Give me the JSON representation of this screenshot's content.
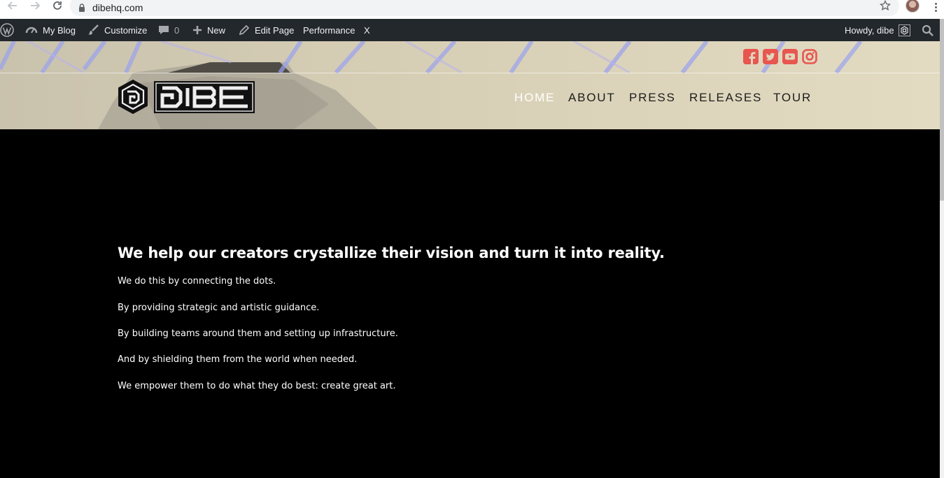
{
  "browser": {
    "url": "dibehq.com",
    "icons": [
      "back-arrow-icon",
      "forward-arrow-icon",
      "reload-icon",
      "lock-icon",
      "bookmark-star-icon",
      "profile-avatar",
      "chrome-menu-icon"
    ]
  },
  "admin_bar": {
    "my_blog": "My Blog",
    "customize": "Customize",
    "comments_count": "0",
    "new": "New",
    "edit_page": "Edit Page",
    "performance": "Performance",
    "x": "X",
    "howdy": "Howdy, dibe",
    "background": "#23282d"
  },
  "header": {
    "social": [
      {
        "name": "facebook",
        "icon": "facebook-icon"
      },
      {
        "name": "twitter",
        "icon": "twitter-icon"
      },
      {
        "name": "youtube",
        "icon": "youtube-icon"
      },
      {
        "name": "instagram",
        "icon": "instagram-icon"
      }
    ],
    "social_color": "#e8564f",
    "logo_text": "DIBE",
    "nav": [
      {
        "label": "HOME",
        "active": true
      },
      {
        "label": "ABOUT",
        "active": false
      },
      {
        "label": "PRESS",
        "active": false
      },
      {
        "label": "RELEASES",
        "active": false
      },
      {
        "label": "TOUR",
        "active": false
      }
    ]
  },
  "content": {
    "headline": "We help our creators crystallize their vision and turn it into reality.",
    "paragraphs": [
      "We do this by connecting the dots.",
      "By providing strategic and artistic guidance.",
      "By building teams around them and setting up infrastructure.",
      "And by shielding them from the world when needed.",
      "We empower them to do what they do best: create great art."
    ]
  }
}
